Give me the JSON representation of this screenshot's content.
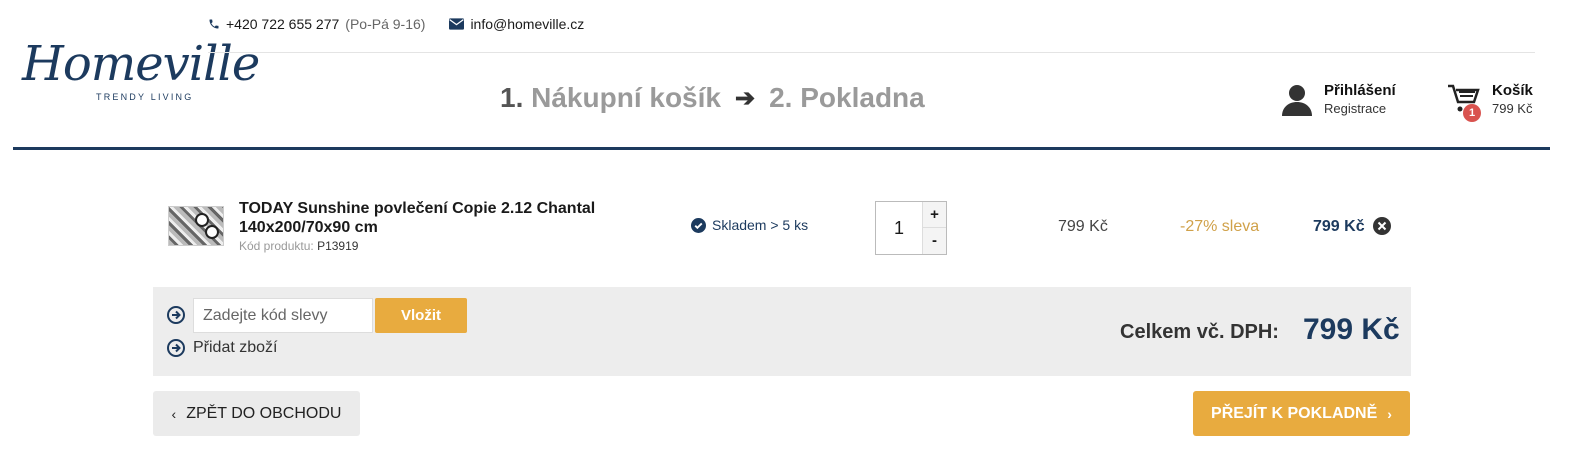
{
  "brand": {
    "name": "Homeville",
    "tagline": "TRENDY LIVING"
  },
  "topbar": {
    "phone": "+420 722 655 277",
    "hours": "(Po-Pá 9-16)",
    "email": "info@homeville.cz"
  },
  "steps": {
    "step1_num": "1.",
    "step1_label": "Nákupní košík",
    "arrow": "➔",
    "step2_num": "2.",
    "step2_label": "Pokladna"
  },
  "account": {
    "login": "Přihlášení",
    "register": "Registrace"
  },
  "cart": {
    "label": "Košík",
    "amount": "799 Kč",
    "count": "1"
  },
  "item": {
    "name": "TODAY Sunshine povlečení Copie 2.12 Chantal 140x200/70x90 cm",
    "code_label": "Kód produktu:",
    "code": "P13919",
    "stock": "Skladem > 5 ks",
    "quantity": "1",
    "plus": "+",
    "minus": "-",
    "price": "799 Kč",
    "discount": "-27% sleva",
    "total": "799 Kč"
  },
  "coupon": {
    "placeholder": "Zadejte kód slevy",
    "insert_label": "Vložit",
    "add_label": "Přidat zboží"
  },
  "summary": {
    "label": "Celkem vč. DPH:",
    "value": "799 Kč"
  },
  "nav": {
    "back_label": "ZPĚT DO OBCHODU",
    "next_label": "PŘEJÍT K POKLADNĚ"
  },
  "colors": {
    "brand": "#1c3a5e",
    "accent": "#e8ab3f",
    "discount": "#d0a149",
    "badge": "#d9534f"
  }
}
